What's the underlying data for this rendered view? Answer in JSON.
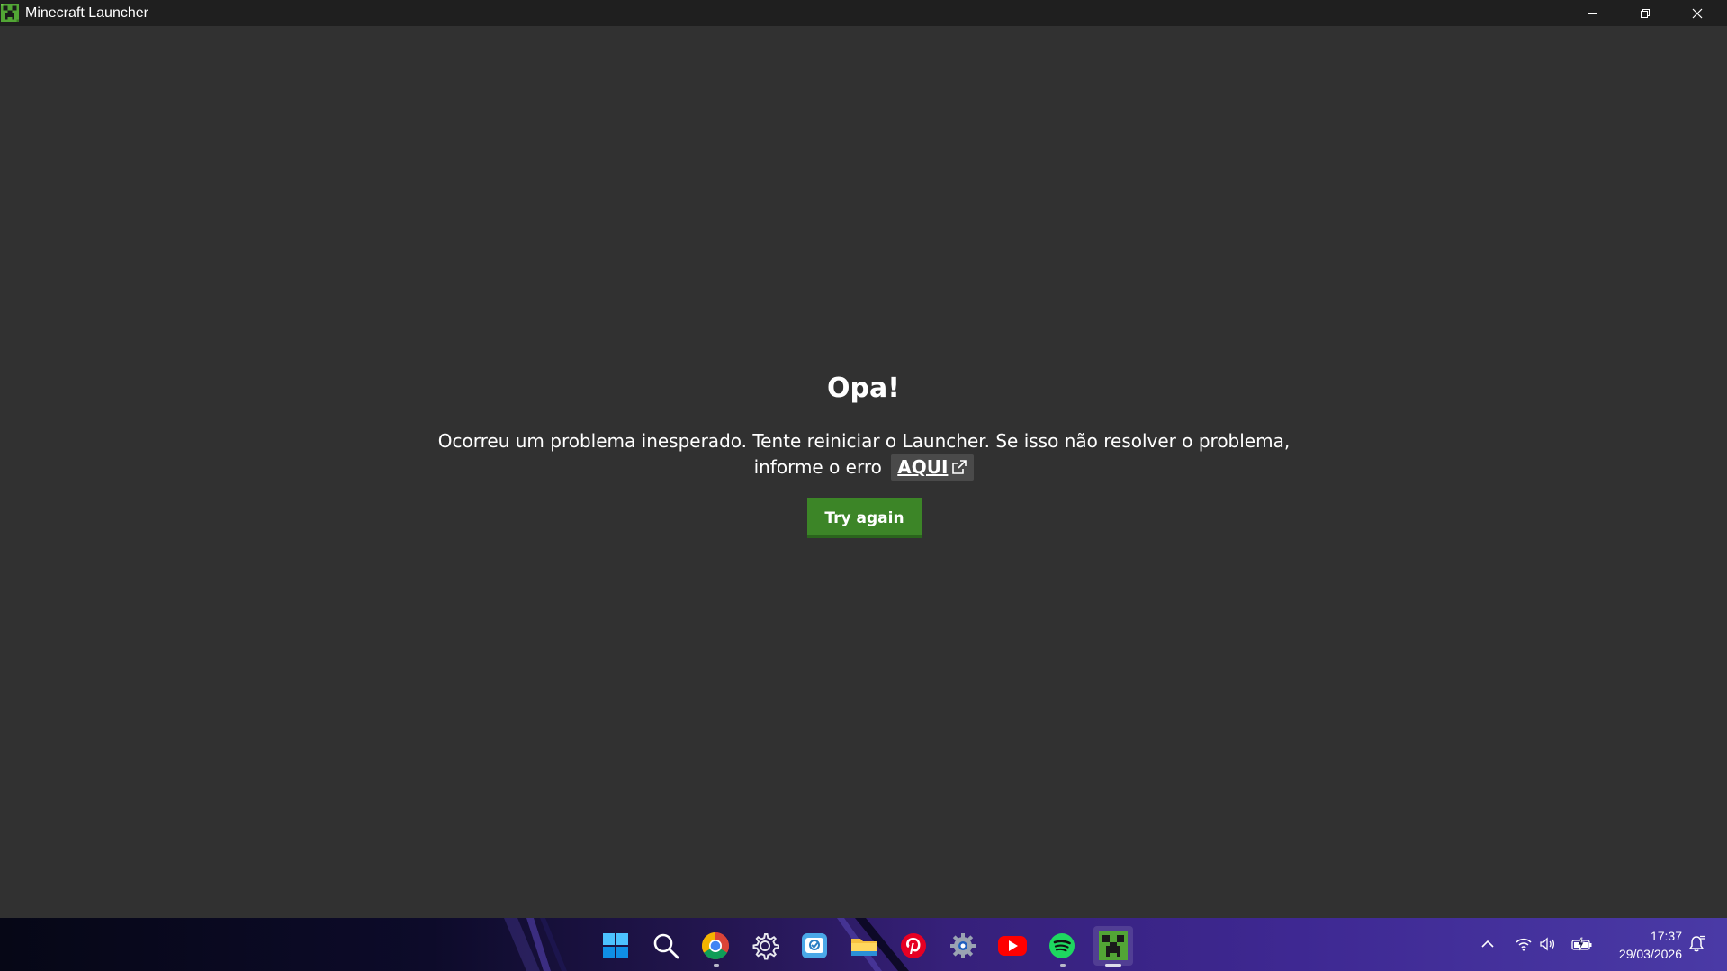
{
  "window": {
    "title": "Minecraft Launcher"
  },
  "error": {
    "title": "Opa!",
    "message": "Ocorreu um problema inesperado. Tente reiniciar o Launcher. Se isso não resolver o problema, informe o erro",
    "link_label": "AQUI",
    "retry_label": "Try again"
  },
  "taskbar": {
    "apps": [
      {
        "name": "start",
        "icon": "windows-start-icon"
      },
      {
        "name": "search",
        "icon": "search-icon"
      },
      {
        "name": "chrome",
        "icon": "chrome-icon"
      },
      {
        "name": "settings",
        "icon": "gear-icon"
      },
      {
        "name": "app",
        "icon": "app-icon"
      },
      {
        "name": "file-explorer",
        "icon": "folder-icon"
      },
      {
        "name": "pinterest",
        "icon": "pinterest-icon"
      },
      {
        "name": "settings-app",
        "icon": "settings-app-icon"
      },
      {
        "name": "youtube",
        "icon": "youtube-icon"
      },
      {
        "name": "spotify",
        "icon": "spotify-icon"
      },
      {
        "name": "minecraft-launcher",
        "icon": "minecraft-icon"
      }
    ],
    "clock_time": "17:37",
    "clock_date": "29/03/2026"
  },
  "colors": {
    "background": "#313131",
    "titlebar": "#1f1f1f",
    "button": "#3c8527",
    "link_bg": "#4a4a4a"
  }
}
